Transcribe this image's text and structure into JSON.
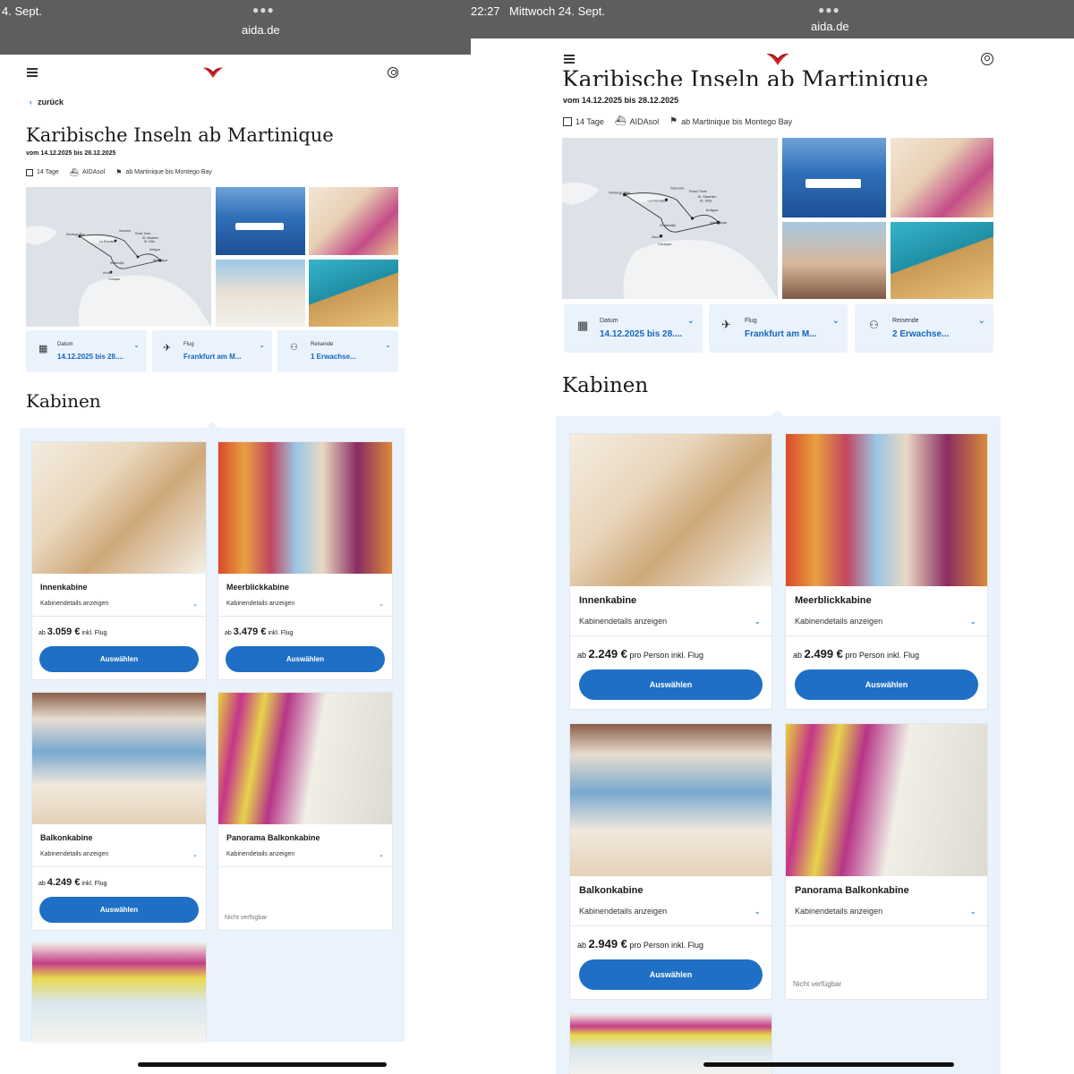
{
  "left": {
    "status_time": "4. Sept.",
    "url": "aida.de",
    "back_label": "zurück",
    "title": "Karibische Inseln ab Martinique",
    "date_range": "vom 14.12.2025 bis 28.12.2025",
    "meta": {
      "duration": "14 Tage",
      "ship": "AIDAsol",
      "route": "ab Martinique bis Montego Bay"
    },
    "selectors": [
      {
        "label": "Datum",
        "value": "14.12.2025 bis 28...."
      },
      {
        "label": "Flug",
        "value": "Frankfurt am M..."
      },
      {
        "label": "Reisende",
        "value": "1 Erwachse..."
      }
    ],
    "section_title": "Kabinen",
    "cards": [
      {
        "name": "Innenkabine",
        "details": "Kabinendetails anzeigen",
        "price_prefix": "ab",
        "price": "3.059 €",
        "price_suffix": "inkl. Flug",
        "button": "Auswählen"
      },
      {
        "name": "Meerblickkabine",
        "details": "Kabinendetails anzeigen",
        "price_prefix": "ab",
        "price": "3.479 €",
        "price_suffix": "inkl. Flug",
        "button": "Auswählen"
      },
      {
        "name": "Balkonkabine",
        "details": "Kabinendetails anzeigen",
        "price_prefix": "ab",
        "price": "4.249 €",
        "price_suffix": "inkl. Flug",
        "button": "Auswählen"
      },
      {
        "name": "Panorama Balkonkabine",
        "details": "Kabinendetails anzeigen",
        "unavailable": "Nicht verfügbar"
      }
    ]
  },
  "right": {
    "status_time": "22:27",
    "status_date": "Mittwoch 24. Sept.",
    "url": "aida.de",
    "title": "Karibische Inseln ab Martinique",
    "date_range": "vom 14.12.2025 bis 28.12.2025",
    "meta": {
      "duration": "14 Tage",
      "ship": "AIDAsol",
      "route": "ab Martinique bis Montego Bay"
    },
    "selectors": [
      {
        "label": "Datum",
        "value": "14.12.2025 bis 28...."
      },
      {
        "label": "Flug",
        "value": "Frankfurt am M..."
      },
      {
        "label": "Reisende",
        "value": "2 Erwachse..."
      }
    ],
    "section_title": "Kabinen",
    "cards": [
      {
        "name": "Innenkabine",
        "details": "Kabinendetails anzeigen",
        "price_prefix": "ab",
        "price": "2.249 €",
        "price_suffix": "pro Person inkl. Flug",
        "button": "Auswählen"
      },
      {
        "name": "Meerblickkabine",
        "details": "Kabinendetails anzeigen",
        "price_prefix": "ab",
        "price": "2.499 €",
        "price_suffix": "pro Person inkl. Flug",
        "button": "Auswählen"
      },
      {
        "name": "Balkonkabine",
        "details": "Kabinendetails anzeigen",
        "price_prefix": "ab",
        "price": "2.949 €",
        "price_suffix": "pro Person inkl. Flug",
        "button": "Auswählen"
      },
      {
        "name": "Panorama Balkonkabine",
        "details": "Kabinendetails anzeigen",
        "unavailable": "Nicht verfügbar"
      }
    ]
  },
  "map_labels": [
    "Montego Bay",
    "La Romana",
    "Samana",
    "Road Town",
    "St. Maarten",
    "St. Kitts",
    "Antigua",
    "Martinique",
    "Kralendijk",
    "Aruba",
    "Curaçao"
  ],
  "colors": {
    "accent": "#1e6fc5",
    "panel": "#eaf3fc",
    "logo": "#d6282f",
    "statusbar": "#5e5e5e"
  }
}
